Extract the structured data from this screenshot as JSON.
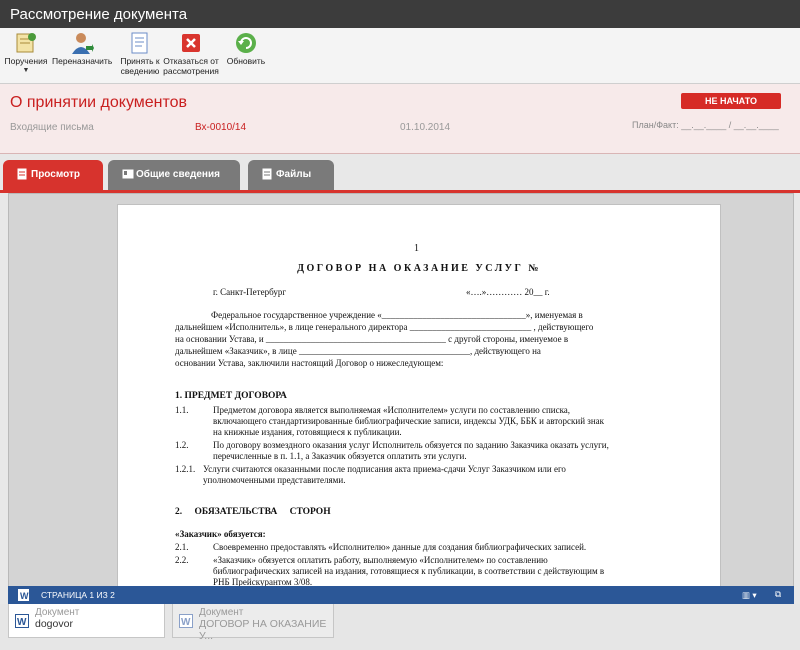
{
  "window": {
    "title": "Рассмотрение документа"
  },
  "toolbar": {
    "assignments": "Поручения",
    "reassign": "Переназначить",
    "accept_line1": "Принять к",
    "accept_line2": "сведению",
    "decline_line1": "Отказаться от",
    "decline_line2": "рассмотрения",
    "refresh": "Обновить"
  },
  "header": {
    "title": "О принятии документов",
    "category": "Входящие письма",
    "number": "Вх-0010/14",
    "date": "01.10.2014",
    "status": "НЕ НАЧАТО",
    "planfact": "План/Факт: __.__.____ / __.__.____"
  },
  "tabs": {
    "view": "Просмотр",
    "general": "Общие сведения",
    "files": "Файлы"
  },
  "document": {
    "page_number": "1",
    "title": "ДОГОВОР НА ОКАЗАНИЕ УСЛУГ №",
    "city": "г. Санкт-Петербург",
    "date_line": "«….»………… 20__ г.",
    "intro": [
      "Федеральное государственное учреждение «________________________________», именуемая в",
      "дальнейшем «Исполнитель», в лице генерального директора ___________________________ , действующего",
      "на основании Устава, и ________________________________________ с другой стороны, именуемое в",
      "дальнейшем «Заказчик», в лице ______________________________________, действующего на",
      "основании Устава, заключили настоящий Договор о нижеследующем:"
    ],
    "section1": "1. ПРЕДМЕТ ДОГОВОРА",
    "items1": [
      {
        "no": "1.1.",
        "lines": [
          "Предметом договора является выполняемая «Исполнителем» услуги по составлению списка,",
          "включающего стандартизированные библиографические записи, индексы УДК, ББК и авторский знак",
          "на книжные издания, готовящиеся к публикации."
        ]
      },
      {
        "no": "1.2.",
        "lines": [
          "По договору возмездного оказания услуг Исполнитель обязуется по заданию Заказчика оказать услуги,",
          "перечисленные в п. 1.1, а Заказчик обязуется оплатить эти услуги."
        ]
      },
      {
        "no": "1.2.1.",
        "lines": [
          "Услуги считаются оказанными после подписания акта приема-сдачи Услуг Заказчиком или его",
          "уполномоченными представителями."
        ]
      }
    ],
    "section2": "2. ОБЯЗАТЕЛЬСТВА СТОРОН",
    "customer_heading": "«Заказчик» обязуется:",
    "items2": [
      {
        "no": "2.1.",
        "lines": [
          "Своевременно предоставлять «Исполнителю» данные для создания библиографических записей."
        ]
      },
      {
        "no": "2.2.",
        "lines": [
          "«Заказчик» обязуется оплатить работу, выполняемую «Исполнителем» по составлению",
          "библиографических записей на издания, готовящиеся к публикации, в соответствии с действующим в",
          "РНБ Прейскурантом 3/08."
        ]
      }
    ]
  },
  "statusbar": {
    "page_info": "СТРАНИЦА 1 ИЗ 2"
  },
  "doc_tabs": [
    {
      "caption": "Документ",
      "name": "dogovor"
    },
    {
      "caption": "Документ",
      "name": "ДОГОВОР НА ОКАЗАНИЕ У..."
    }
  ],
  "colors": {
    "accent": "#d7332d",
    "statusbar": "#2b5797",
    "titlebar": "#3c3c3c"
  }
}
